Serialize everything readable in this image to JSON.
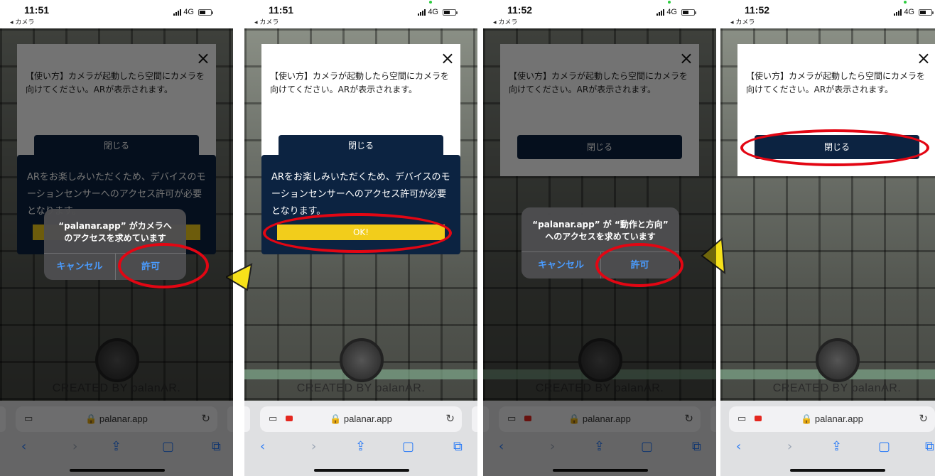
{
  "status": {
    "back_label": "◂ カメラ",
    "network": "4G"
  },
  "phones": [
    {
      "time": "11:51"
    },
    {
      "time": "11:51"
    },
    {
      "time": "11:52"
    },
    {
      "time": "11:52"
    }
  ],
  "instruction_dialog": {
    "close_icon": "×",
    "text": "【使い方】カメラが起動したら空間にカメラを向けてください。ARが表示されます。",
    "close_button": "閉じる"
  },
  "sensor_dialog": {
    "text": "ARをお楽しみいただくため、デバイスのモーションセンサーへのアクセス許可が必要となります。",
    "ok_button": "OK!"
  },
  "camera_alert": {
    "title": "“palanar.app” がカメラへのアクセスを求めています",
    "cancel": "キャンセル",
    "allow": "許可"
  },
  "motion_alert": {
    "title": "“palanar.app” が “動作と方向” へのアクセスを求めています",
    "cancel": "キャンセル",
    "allow": "許可"
  },
  "footer": {
    "created_by": "CREATED BY palanAR."
  },
  "browser": {
    "url": "palanar.app",
    "lock_icon": "lock-icon",
    "reader_icon": "reader-icon",
    "reload_icon": "reload-icon"
  },
  "colors": {
    "navy": "#0c2341",
    "yellow": "#f2cd1b",
    "highlight_red": "#e30613",
    "ios_blue": "#2a7bf6"
  }
}
